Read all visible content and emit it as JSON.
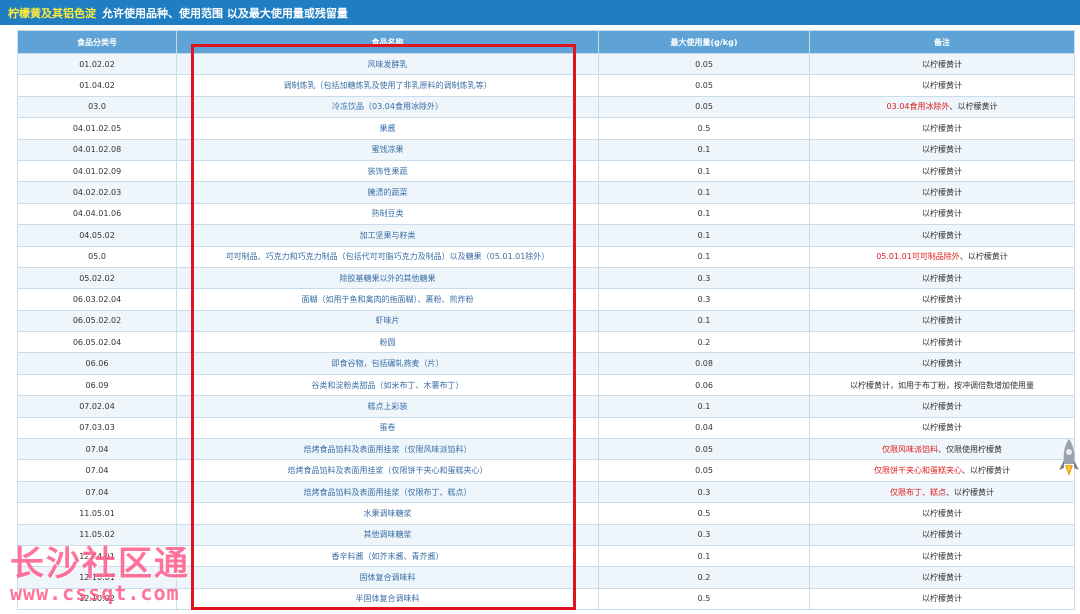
{
  "header": {
    "highlight": "柠檬黄及其铝色淀",
    "title": "允许使用品种、使用范围 以及最大使用量或残留量"
  },
  "table": {
    "headers": [
      "食品分类号",
      "食品名称",
      "最大使用量(g/kg)",
      "备注"
    ],
    "rows": [
      {
        "code": "01.02.02",
        "name": "风味发酵乳",
        "max": "0.05",
        "note_red": "",
        "note": "以柠檬黄计"
      },
      {
        "code": "01.04.02",
        "name": "调制炼乳（包括加糖炼乳及使用了非乳原料的调制炼乳等）",
        "max": "0.05",
        "note_red": "",
        "note": "以柠檬黄计"
      },
      {
        "code": "03.0",
        "name": "冷冻饮品（03.04食用冰除外）",
        "max": "0.05",
        "note_red": "03.04食用冰除外",
        "note": "、以柠檬黄计"
      },
      {
        "code": "04.01.02.05",
        "name": "果酱",
        "max": "0.5",
        "note_red": "",
        "note": "以柠檬黄计"
      },
      {
        "code": "04.01.02.08",
        "name": "蜜饯凉果",
        "max": "0.1",
        "note_red": "",
        "note": "以柠檬黄计"
      },
      {
        "code": "04.01.02.09",
        "name": "装饰性果蔬",
        "max": "0.1",
        "note_red": "",
        "note": "以柠檬黄计"
      },
      {
        "code": "04.02.02.03",
        "name": "腌渍的蔬菜",
        "max": "0.1",
        "note_red": "",
        "note": "以柠檬黄计"
      },
      {
        "code": "04.04.01.06",
        "name": "熟制豆类",
        "max": "0.1",
        "note_red": "",
        "note": "以柠檬黄计"
      },
      {
        "code": "04.05.02",
        "name": "加工坚果与籽类",
        "max": "0.1",
        "note_red": "",
        "note": "以柠檬黄计"
      },
      {
        "code": "05.0",
        "name": "可可制品、巧克力和巧克力制品（包括代可可脂巧克力及制品）以及糖果（05.01.01除外）",
        "max": "0.1",
        "note_red": "05.01.01可可制品除外",
        "note": "、以柠檬黄计"
      },
      {
        "code": "05.02.02",
        "name": "除胶基糖果以外的其他糖果",
        "max": "0.3",
        "note_red": "",
        "note": "以柠檬黄计"
      },
      {
        "code": "06.03.02.04",
        "name": "面糊（如用于鱼和禽肉的拖面糊）、裹粉、煎炸粉",
        "max": "0.3",
        "note_red": "",
        "note": "以柠檬黄计"
      },
      {
        "code": "06.05.02.02",
        "name": "虾味片",
        "max": "0.1",
        "note_red": "",
        "note": "以柠檬黄计"
      },
      {
        "code": "06.05.02.04",
        "name": "粉圆",
        "max": "0.2",
        "note_red": "",
        "note": "以柠檬黄计"
      },
      {
        "code": "06.06",
        "name": "即食谷物，包括碾轧燕麦（片）",
        "max": "0.08",
        "note_red": "",
        "note": "以柠檬黄计"
      },
      {
        "code": "06.09",
        "name": "谷类和淀粉类甜品（如米布丁、木薯布丁）",
        "max": "0.06",
        "note_red": "",
        "note": "以柠檬黄计，如用于布丁粉，按冲调倍数增加使用量"
      },
      {
        "code": "07.02.04",
        "name": "糕点上彩装",
        "max": "0.1",
        "note_red": "",
        "note": "以柠檬黄计"
      },
      {
        "code": "07.03.03",
        "name": "蛋卷",
        "max": "0.04",
        "note_red": "",
        "note": "以柠檬黄计"
      },
      {
        "code": "07.04",
        "name": "焙烤食品馅料及表面用挂浆（仅限风味派馅料）",
        "max": "0.05",
        "note_red": "仅限风味派馅料",
        "note": "、仅限使用柠檬黄"
      },
      {
        "code": "07.04",
        "name": "焙烤食品馅料及表面用挂浆（仅限饼干夹心和蛋糕夹心）",
        "max": "0.05",
        "note_red": "仅限饼干夹心和蛋糕夹心",
        "note": "、以柠檬黄计"
      },
      {
        "code": "07.04",
        "name": "焙烤食品馅料及表面用挂浆（仅限布丁、糕点）",
        "max": "0.3",
        "note_red": "仅限布丁、糕点",
        "note": "、以柠檬黄计"
      },
      {
        "code": "11.05.01",
        "name": "水果调味糖浆",
        "max": "0.5",
        "note_red": "",
        "note": "以柠檬黄计"
      },
      {
        "code": "11.05.02",
        "name": "其他调味糖浆",
        "max": "0.3",
        "note_red": "",
        "note": "以柠檬黄计"
      },
      {
        "code": "12.04.01",
        "name": "香辛料酱（如芥末酱、青芥酱）",
        "max": "0.1",
        "note_red": "",
        "note": "以柠檬黄计"
      },
      {
        "code": "12.10.01",
        "name": "固体复合调味料",
        "max": "0.2",
        "note_red": "",
        "note": "以柠檬黄计"
      },
      {
        "code": "12.10.02",
        "name": "半固体复合调味料",
        "max": "0.5",
        "note_red": "",
        "note": "以柠檬黄计"
      }
    ]
  },
  "watermark": {
    "line1": "长沙社区通",
    "line2": "www.cssqt.com"
  },
  "colors": {
    "header_bg": "#1e7ec1",
    "table_head_bg": "#5fa3d6",
    "highlight_box": "#e0141e",
    "note_red": "#e02020"
  },
  "icons": {
    "rocket": "rocket-icon"
  }
}
